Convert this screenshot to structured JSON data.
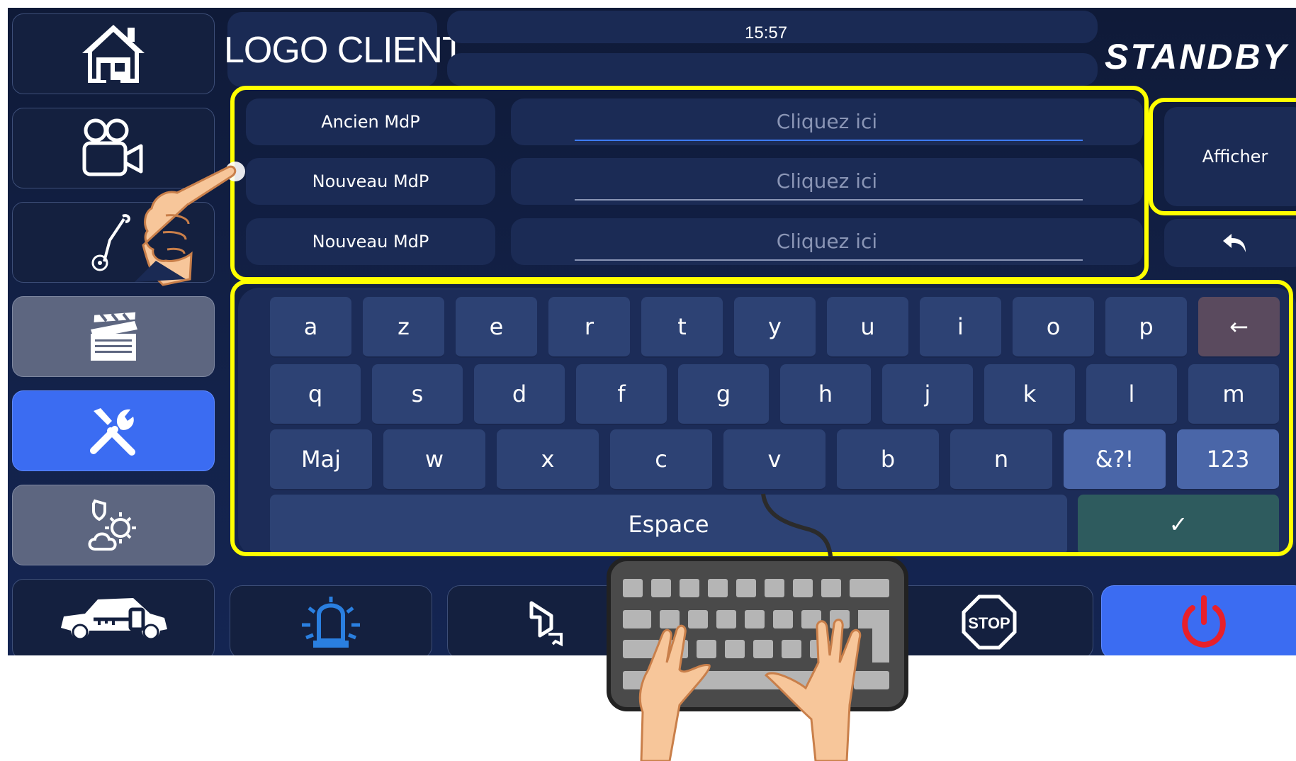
{
  "header": {
    "logo_text": "LOGO CLIENT",
    "time": "15:57",
    "brand": "STANDBY"
  },
  "sidebar": {
    "items": [
      {
        "icon": "home-icon",
        "state": "normal"
      },
      {
        "icon": "camera-icon",
        "state": "normal"
      },
      {
        "icon": "golf-trolley-icon",
        "state": "normal"
      },
      {
        "icon": "clapperboard-icon",
        "state": "grey"
      },
      {
        "icon": "tools-icon",
        "state": "active"
      },
      {
        "icon": "weather-icon",
        "state": "grey"
      },
      {
        "icon": "car-key-icon",
        "state": "normal"
      }
    ]
  },
  "password_form": {
    "rows": [
      {
        "label": "Ancien MdP",
        "placeholder": "Cliquez ici"
      },
      {
        "label": "Nouveau MdP",
        "placeholder": "Cliquez ici"
      },
      {
        "label": "Nouveau MdP",
        "placeholder": "Cliquez ici"
      }
    ],
    "show_label": "Afficher",
    "back_icon": "undo-arrow-icon"
  },
  "keyboard": {
    "row1": [
      "a",
      "z",
      "e",
      "r",
      "t",
      "y",
      "u",
      "i",
      "o",
      "p",
      "←"
    ],
    "row2": [
      "q",
      "s",
      "d",
      "f",
      "g",
      "h",
      "j",
      "k",
      "l",
      "m"
    ],
    "row3": [
      "Maj",
      "w",
      "x",
      "c",
      "v",
      "b",
      "n",
      "&?!",
      "123"
    ],
    "space_label": "Espace",
    "ok_label": "✓"
  },
  "bottom_bar": {
    "items": [
      {
        "icon": "beacon-light-icon"
      },
      {
        "icon": "speaker-icon"
      },
      {
        "icon": "stop-sign-icon",
        "label": "STOP"
      },
      {
        "icon": "power-icon"
      }
    ]
  },
  "colors": {
    "highlight": "#ffff00",
    "active": "#3b6cf2",
    "power": "#e8202a",
    "beacon": "#2a7fe0"
  }
}
